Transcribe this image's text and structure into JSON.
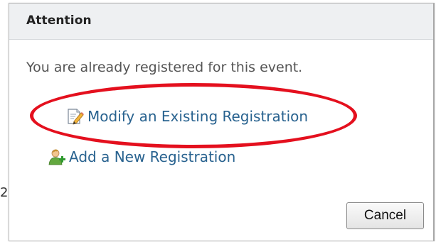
{
  "background_fragment": "2",
  "dialog": {
    "title": "Attention",
    "message": "You are already registered for this event.",
    "options": [
      {
        "label": "Modify an Existing Registration",
        "icon": "edit-document-icon"
      },
      {
        "label": "Add a New Registration",
        "icon": "add-user-icon"
      }
    ],
    "cancel_label": "Cancel"
  },
  "colors": {
    "link": "#28628f",
    "highlight": "#e4101e",
    "header_bg": "#eef0f2"
  }
}
